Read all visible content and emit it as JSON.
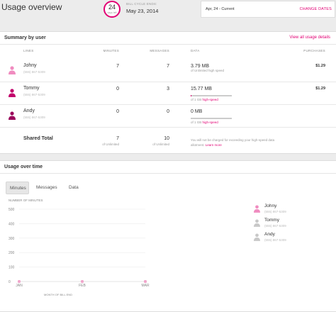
{
  "header": {
    "title": "Usage overview",
    "days_left": "24",
    "days_left_label": "days left",
    "bill_cycle_label": "BILL CYCLE ENDS:",
    "bill_cycle_date": "May 23, 2014",
    "range": "Apr, 24 - Current",
    "change_dates": "CHANGE DATES"
  },
  "summary": {
    "title": "Summary by user",
    "link": "View all usage details",
    "columns": [
      "LINES",
      "MINUTES",
      "MESSAGES",
      "DATA",
      "PURCHASES"
    ],
    "users": [
      {
        "name": "Johny",
        "phone": "(555) 867-5309",
        "minutes": "7",
        "messages": "7",
        "data": "3.79 MB",
        "data_note": "of Unlimited high speed",
        "data_fraction": 0,
        "purchase": "$1.29",
        "color": "#f08cc0"
      },
      {
        "name": "Tommy",
        "phone": "(555) 867-5309",
        "minutes": "0",
        "messages": "3",
        "data": "15.77 MB",
        "data_note_prefix": "of 1 GB ",
        "data_note_link": "high-speed",
        "data_fraction": 0.02,
        "purchase": "$1.29",
        "color": "#c2006b"
      },
      {
        "name": "Andy",
        "phone": "(555) 867-5309",
        "minutes": "0",
        "messages": "0",
        "data": "0 MB",
        "data_note_prefix": "of 1 GB ",
        "data_note_link": "high-speed",
        "data_fraction": 0,
        "purchase": "",
        "color": "#9b0a5c"
      }
    ],
    "total": {
      "label": "Shared Total",
      "minutes": "7",
      "minutes_sub": "of Unlimited",
      "messages": "10",
      "messages_sub": "of Unlimited",
      "note": "You will not be charged for exceeding your high-speed data allotment.",
      "note_link": "Learn more"
    }
  },
  "usage_time": {
    "title": "Usage over time",
    "tabs": [
      "Minutes",
      "Messages",
      "Data"
    ],
    "active_tab": "Minutes"
  },
  "chart_data": {
    "type": "line",
    "ylabel": "NUMBER OF MINUTES",
    "xlabel": "MONTH OF BILL END",
    "categories": [
      "JAN",
      "FEB",
      "MAR"
    ],
    "yticks": [
      "500",
      "400",
      "300",
      "200",
      "100",
      "0"
    ],
    "ylim": [
      0,
      500
    ],
    "series": [
      {
        "name": "Johny",
        "values": [
          0,
          0,
          0
        ]
      },
      {
        "name": "Tommy",
        "values": [
          0,
          0,
          0
        ]
      },
      {
        "name": "Andy",
        "values": [
          0,
          0,
          0
        ]
      }
    ],
    "grid": true,
    "legend": "right",
    "marker_color": "#f0a6cb"
  },
  "legend": [
    {
      "name": "Johny",
      "phone": "(555) 867-5309",
      "color": "#f08cc0"
    },
    {
      "name": "Tommy",
      "phone": "(555) 867-5309",
      "color": "#c8c8c8"
    },
    {
      "name": "Andy",
      "phone": "(555) 867-5309",
      "color": "#c8c8c8"
    }
  ]
}
